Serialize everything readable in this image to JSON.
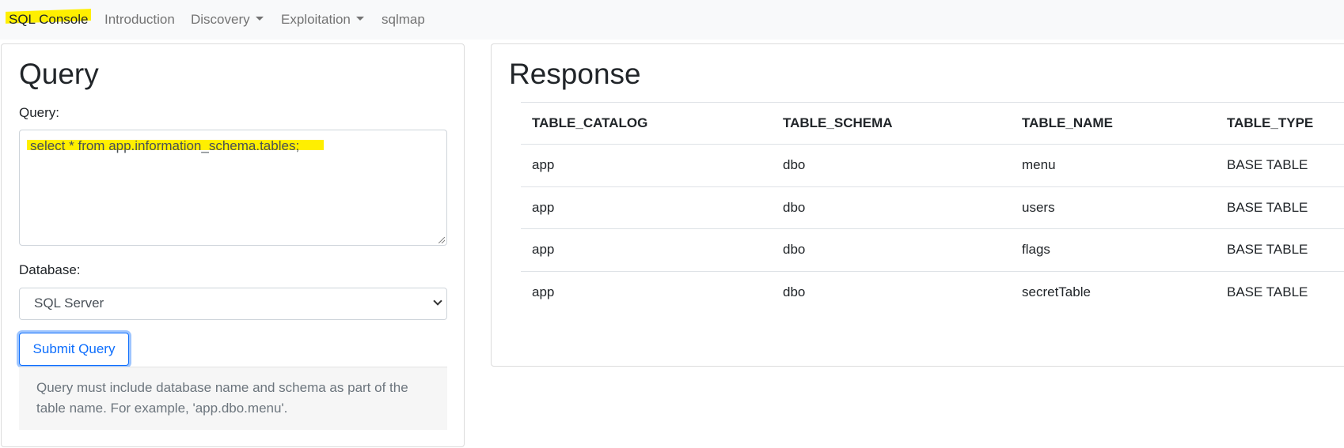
{
  "nav": {
    "brand": "SQL Console",
    "items": [
      {
        "label": "Introduction"
      },
      {
        "label": "Discovery"
      },
      {
        "label": "Exploitation"
      },
      {
        "label": "sqlmap"
      }
    ]
  },
  "query_panel": {
    "title": "Query",
    "query_label": "Query:",
    "query_value": "select * from app.information_schema.tables;",
    "database_label": "Database:",
    "database_selected": "SQL Server",
    "submit_label": "Submit Query",
    "help_text": "Query must include database name and schema as part of the table name. For example, 'app.dbo.menu'."
  },
  "response_panel": {
    "title": "Response",
    "columns": [
      "TABLE_CATALOG",
      "TABLE_SCHEMA",
      "TABLE_NAME",
      "TABLE_TYPE"
    ],
    "rows": [
      [
        "app",
        "dbo",
        "menu",
        "BASE TABLE"
      ],
      [
        "app",
        "dbo",
        "users",
        "BASE TABLE"
      ],
      [
        "app",
        "dbo",
        "flags",
        "BASE TABLE"
      ],
      [
        "app",
        "dbo",
        "secretTable",
        "BASE TABLE"
      ]
    ]
  },
  "colors": {
    "highlight": "#ffef00",
    "accent": "#0d6efd",
    "navbar_bg": "#f8f9fa"
  }
}
